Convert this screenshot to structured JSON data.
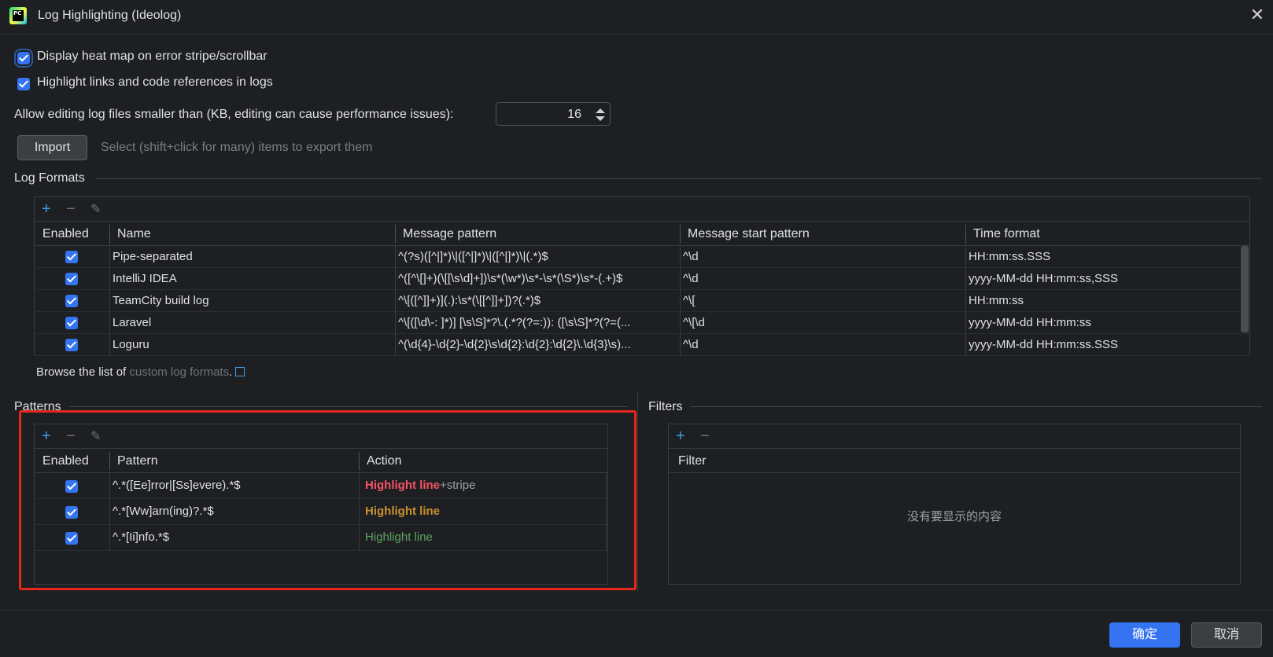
{
  "window": {
    "title": "Log Highlighting (Ideolog)",
    "icon_text": "PC"
  },
  "settings": {
    "heatmap_label": "Display heat map on error stripe/scrollbar",
    "heatmap_checked": true,
    "links_label": "Highlight links and code references in logs",
    "links_checked": true,
    "editing_label": "Allow editing log files smaller than (KB, editing can cause performance issues):",
    "editing_value": "16"
  },
  "import": {
    "button_label": "Import",
    "hint": "Select (shift+click for many) items to export them"
  },
  "log_formats": {
    "title": "Log Formats",
    "columns": [
      "Enabled",
      "Name",
      "Message pattern",
      "Message start pattern",
      "Time format"
    ],
    "rows": [
      {
        "enabled": true,
        "name": "Pipe-separated",
        "pattern": "^(?s)([^|]*)\\|([^|]*)\\|([^|]*)\\|(.*)$",
        "start": "^\\d",
        "time": "HH:mm:ss.SSS"
      },
      {
        "enabled": true,
        "name": "IntelliJ IDEA",
        "pattern": "^([^\\[]+)(\\[[\\s\\d]+])\\s*(\\w*)\\s*-\\s*(\\S*)\\s*-(.+)$",
        "start": "^\\d",
        "time": "yyyy-MM-dd HH:mm:ss,SSS"
      },
      {
        "enabled": true,
        "name": "TeamCity build log",
        "pattern": "^\\[([^]]+)](.):\\s*(\\[[^]]+])?(.*)$",
        "start": "^\\[",
        "time": "HH:mm:ss"
      },
      {
        "enabled": true,
        "name": "Laravel",
        "pattern": "^\\[([\\d\\-: ]*)] [\\s\\S]*?\\.(.*?(?=:)): ([\\s\\S]*?(?=(...",
        "start": "^\\[\\d",
        "time": "yyyy-MM-dd HH:mm:ss"
      },
      {
        "enabled": true,
        "name": "Loguru",
        "pattern": "^(\\d{4}-\\d{2}-\\d{2}\\s\\d{2}:\\d{2}:\\d{2}\\.\\d{3}\\s)...",
        "start": "^\\d",
        "time": "yyyy-MM-dd HH:mm:ss.SSS"
      }
    ],
    "browse_prefix": "Browse the list of",
    "browse_link": "custom log formats",
    "browse_suffix": "."
  },
  "patterns": {
    "title": "Patterns",
    "columns": [
      "Enabled",
      "Pattern",
      "Action"
    ],
    "rows": [
      {
        "enabled": true,
        "pattern": "^.*([Ee]rror|[Ss]evere).*$",
        "action_main": "Highlight line",
        "action_extra": "+stripe",
        "color": "#f75464"
      },
      {
        "enabled": true,
        "pattern": "^.*[Ww]arn(ing)?.*$",
        "action_main": "Highlight line",
        "action_extra": "",
        "color": "#c7912f"
      },
      {
        "enabled": true,
        "pattern": "^.*[Ii]nfo.*$",
        "action_main": "Highlight line",
        "action_extra": "",
        "color": "#5fa35f"
      }
    ]
  },
  "filters": {
    "title": "Filters",
    "column": "Filter",
    "empty_text": "没有要显示的内容"
  },
  "footer": {
    "ok_label": "确定",
    "cancel_label": "取消"
  },
  "colors": {
    "accent": "#3574f0",
    "annotation_box": "#e5281b"
  }
}
